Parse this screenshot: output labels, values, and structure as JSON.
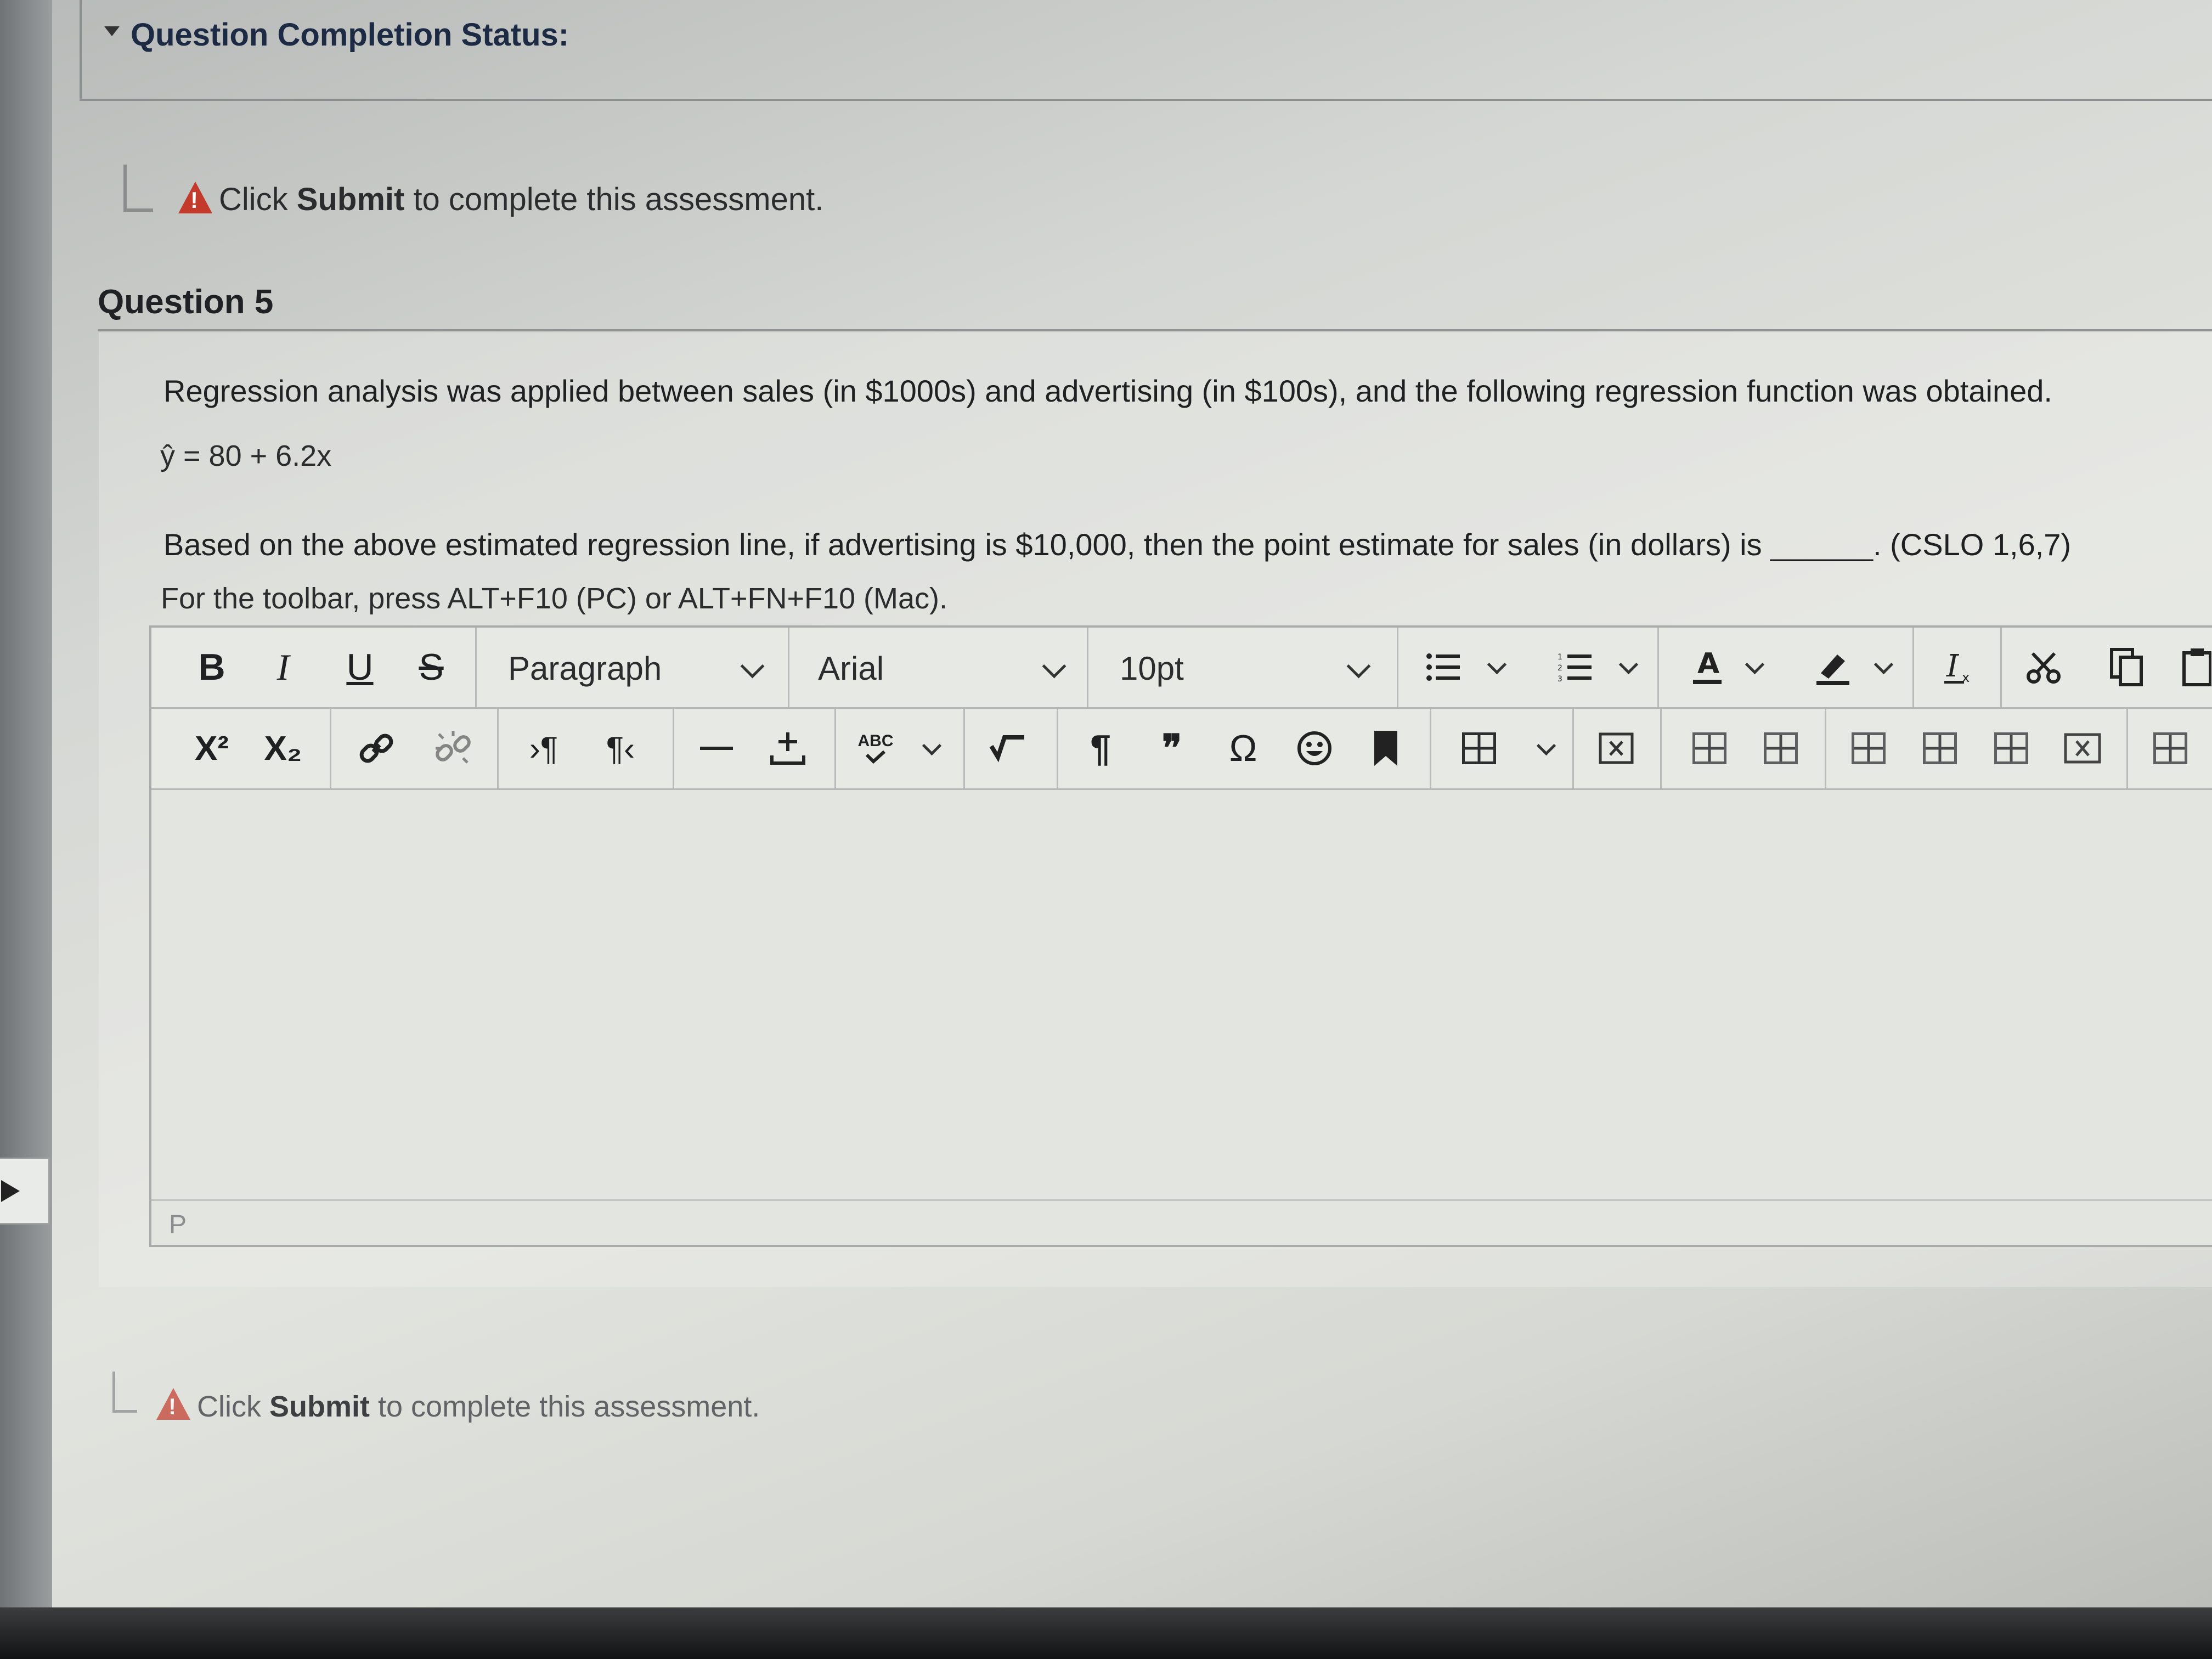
{
  "status": {
    "title": "Question Completion Status:"
  },
  "instructions": {
    "top_prefix": "Click ",
    "top_bold": "Submit",
    "top_suffix": " to complete this assessment.",
    "bottom_prefix": "Click ",
    "bottom_bold": "Submit",
    "bottom_suffix": " to complete this assessment."
  },
  "question": {
    "title": "Question 5",
    "line1": "Regression analysis was applied between sales (in $1000s) and advertising (in $100s), and the following regression function was obtained.",
    "equation": "ŷ = 80 + 6.2x",
    "line2": "Based on the above estimated regression line, if advertising is $10,000, then the point estimate for sales (in dollars) is ______. (CSLO 1,6,7)",
    "toolbar_hint": "For the toolbar, press ALT+F10 (PC) or ALT+FN+F10 (Mac)."
  },
  "editor": {
    "bold": "B",
    "italic": "I",
    "underline": "U",
    "strike": "S",
    "block_format": "Paragraph",
    "font_family": "Arial",
    "font_size": "10pt",
    "superscript": "X²",
    "subscript": "X₂",
    "spellcheck": "ABC",
    "pilcrow": "¶",
    "quote": "❞",
    "omega": "Ω",
    "path": "P"
  },
  "icons": [
    "warning-icon",
    "bullet-list-icon",
    "numbered-list-icon",
    "text-color-icon",
    "highlight-icon",
    "clear-format-icon",
    "cut-icon",
    "copy-icon",
    "link-icon",
    "unlink-icon",
    "ltr-icon",
    "rtl-icon",
    "horizontal-rule-icon",
    "insert-icon",
    "spellcheck-icon",
    "math-icon",
    "pilcrow-icon",
    "blockquote-icon",
    "special-char-icon",
    "emoji-icon",
    "bookmark-icon",
    "table-icon"
  ]
}
